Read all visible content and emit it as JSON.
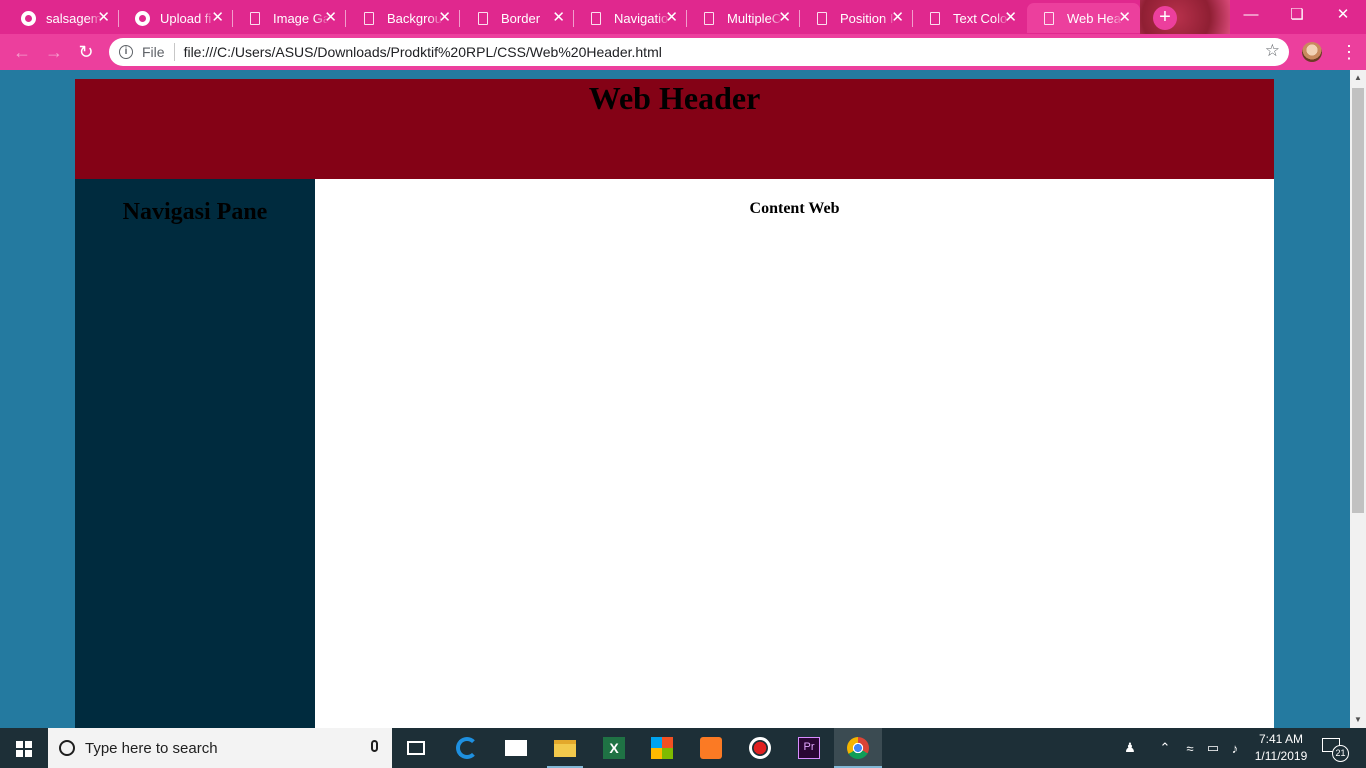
{
  "browser": {
    "tabs": [
      {
        "title": "salsagem",
        "icon": "github-icon"
      },
      {
        "title": "Upload fi",
        "icon": "github-icon"
      },
      {
        "title": "Image Ga",
        "icon": "document-icon"
      },
      {
        "title": "Backgrou",
        "icon": "document-icon"
      },
      {
        "title": "Border",
        "icon": "document-icon"
      },
      {
        "title": "Navigatio",
        "icon": "document-icon"
      },
      {
        "title": "MultipleC",
        "icon": "document-icon"
      },
      {
        "title": "Position I",
        "icon": "document-icon"
      },
      {
        "title": "Text Colo",
        "icon": "document-icon"
      },
      {
        "title": "Web Hea",
        "icon": "document-icon",
        "active": true
      }
    ],
    "address": {
      "scheme_label": "File",
      "url": "file:///C:/Users/ASUS/Downloads/Prodktif%20RPL/CSS/Web%20Header.html"
    },
    "theme_color": "#e0288e"
  },
  "page": {
    "header_title": "Web Header",
    "nav_title": "Navigasi Pane",
    "content_title": "Content Web",
    "colors": {
      "background": "#247aa0",
      "header": "#840216",
      "nav": "#002b3e",
      "content": "#ffffff"
    }
  },
  "taskbar": {
    "search_placeholder": "Type here to search",
    "time": "7:41 AM",
    "date": "1/11/2019",
    "notification_count": "21"
  }
}
